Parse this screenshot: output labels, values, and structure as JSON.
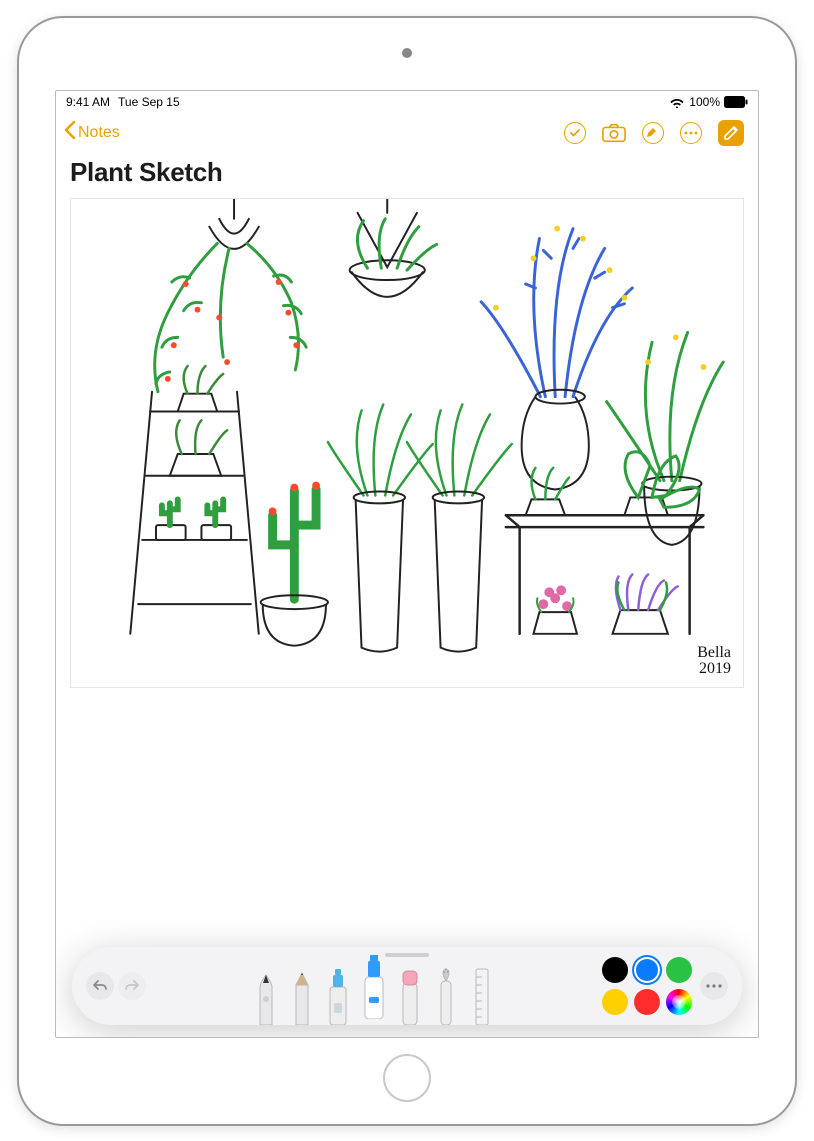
{
  "status": {
    "time": "9:41 AM",
    "date": "Tue Sep 15",
    "battery_pct": "100%"
  },
  "nav": {
    "back_label": "Notes"
  },
  "note": {
    "title": "Plant Sketch",
    "signature_name": "Bella",
    "signature_year": "2019"
  },
  "tools": {
    "list": [
      "pen",
      "pencil",
      "marker",
      "highlighter",
      "eraser",
      "lasso",
      "ruler"
    ],
    "selected_index": 3
  },
  "colors": {
    "swatches": [
      "#000000",
      "#0a7bff",
      "#29c244",
      "#ffcf00",
      "#ff2d2d"
    ],
    "selected_index": 1,
    "accent": "#e9a100"
  }
}
